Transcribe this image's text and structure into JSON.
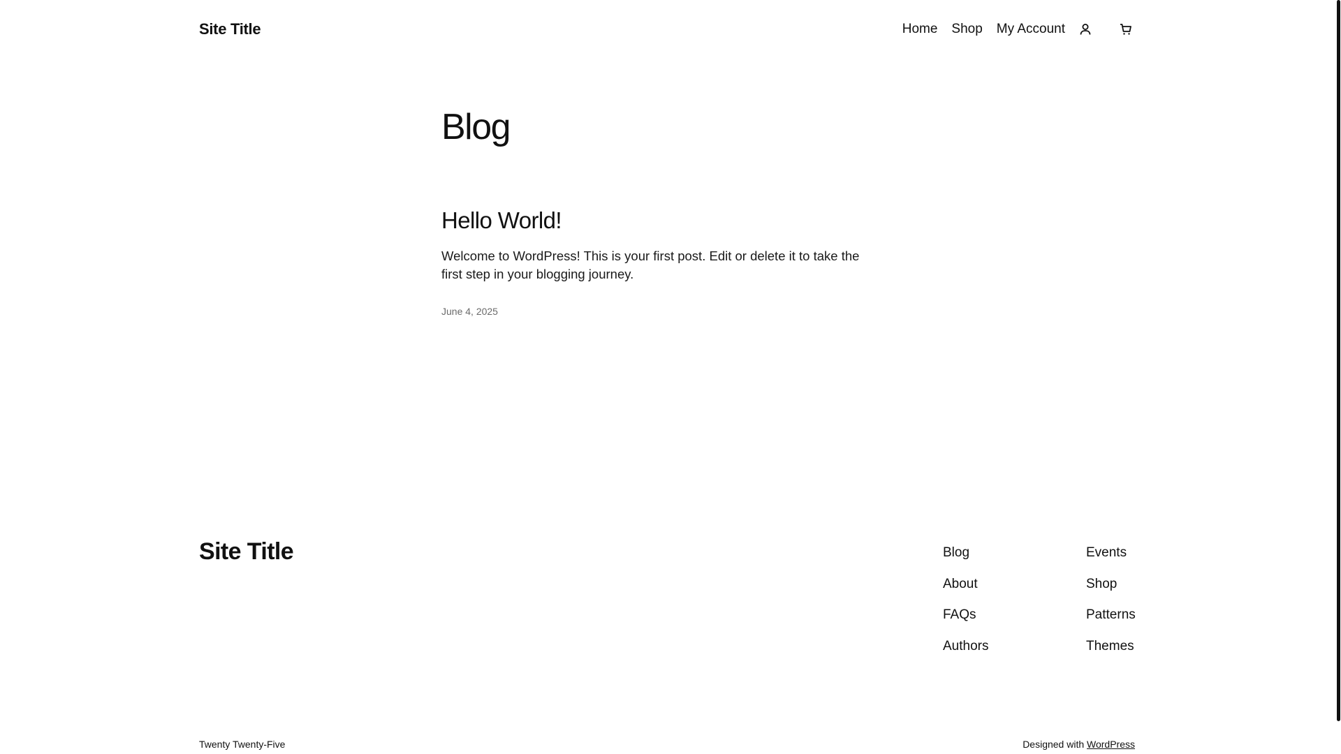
{
  "header": {
    "site_title": "Site Title",
    "nav": {
      "home": "Home",
      "shop": "Shop",
      "my_account": "My Account"
    },
    "icons": [
      "user-icon",
      "cart-icon"
    ]
  },
  "main": {
    "heading": "Blog",
    "posts": [
      {
        "title": "Hello World!",
        "excerpt": "Welcome to WordPress! This is your first post. Edit or delete it to take the first step in your blogging journey.",
        "date": "June 4, 2025"
      }
    ]
  },
  "footer": {
    "site_title": "Site Title",
    "col1": [
      "Blog",
      "About",
      "FAQs",
      "Authors"
    ],
    "col2": [
      "Events",
      "Shop",
      "Patterns",
      "Themes"
    ],
    "theme_name": "Twenty Twenty-Five",
    "designed_with": "Designed with",
    "wordpress_link": "WordPress"
  }
}
